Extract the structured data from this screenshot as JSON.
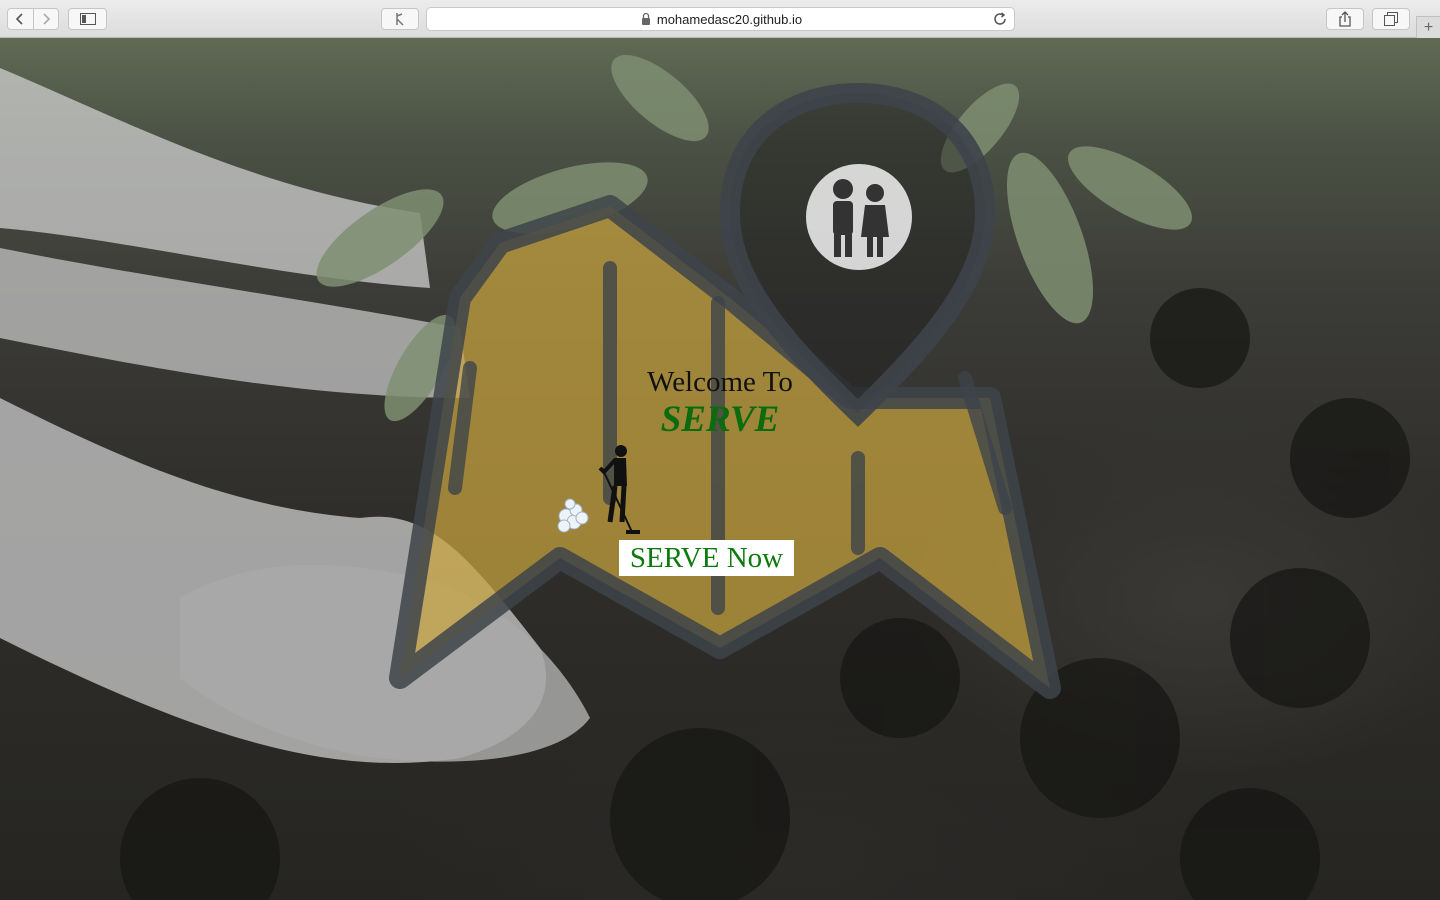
{
  "browser": {
    "url": "mohamedasc20.github.io",
    "icons": {
      "back": "chevron-left-icon",
      "forward": "chevron-right-icon",
      "sidebar": "sidebar-icon",
      "reader": "reader-icon",
      "lock": "lock-icon",
      "reload": "reload-icon",
      "share": "share-icon",
      "tabs": "tabs-overview-icon",
      "new_tab": "plus-icon"
    }
  },
  "hero": {
    "welcome": "Welcome To",
    "brand": "SERVE",
    "cta_label": "SERVE Now"
  },
  "colors": {
    "brand_green": "#0c6b0c",
    "map_fill": "#c9a53f",
    "map_outline": "#3e444a"
  }
}
